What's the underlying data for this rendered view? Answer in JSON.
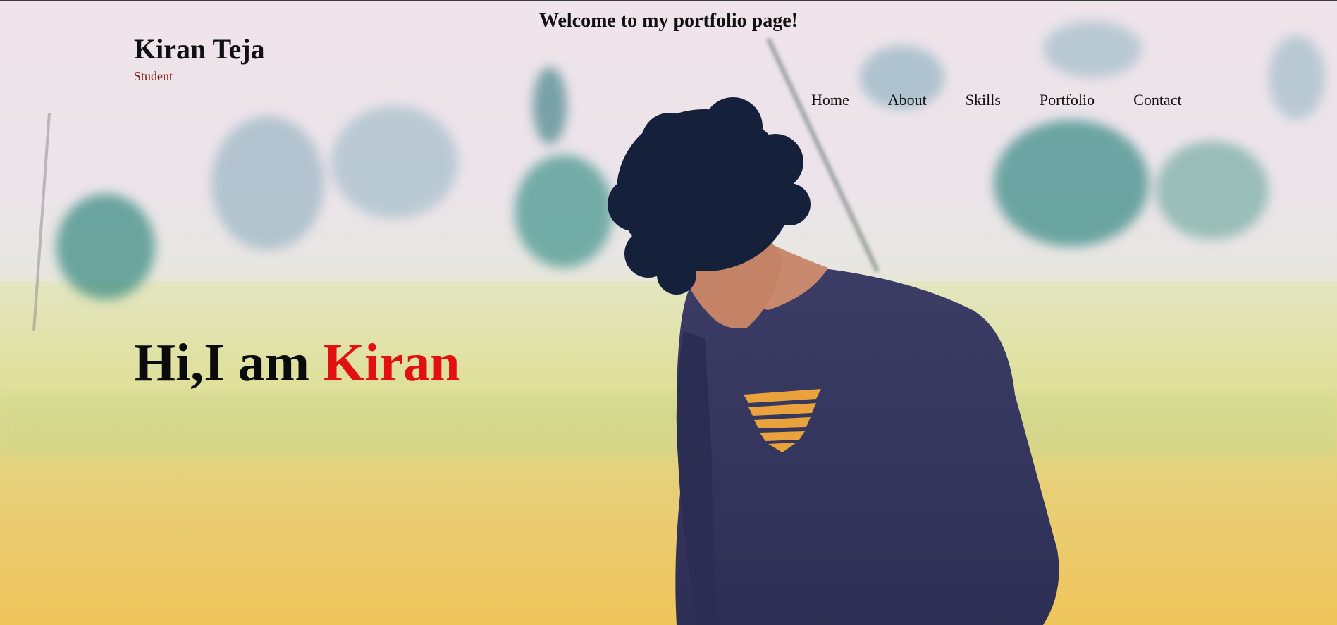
{
  "header": {
    "welcome": "Welcome to my portfolio page!"
  },
  "brand": {
    "name": "Kiran Teja",
    "role": "Student"
  },
  "nav": {
    "items": [
      {
        "label": "Home"
      },
      {
        "label": "About"
      },
      {
        "label": "Skills"
      },
      {
        "label": "Portfolio"
      },
      {
        "label": "Contact"
      }
    ]
  },
  "hero": {
    "greeting": "Hi,I am ",
    "name": "Kiran",
    "image": "person-in-field-photo"
  },
  "colors": {
    "accent": "#e21111",
    "role_text": "#8b0f0f",
    "text": "#111111"
  }
}
